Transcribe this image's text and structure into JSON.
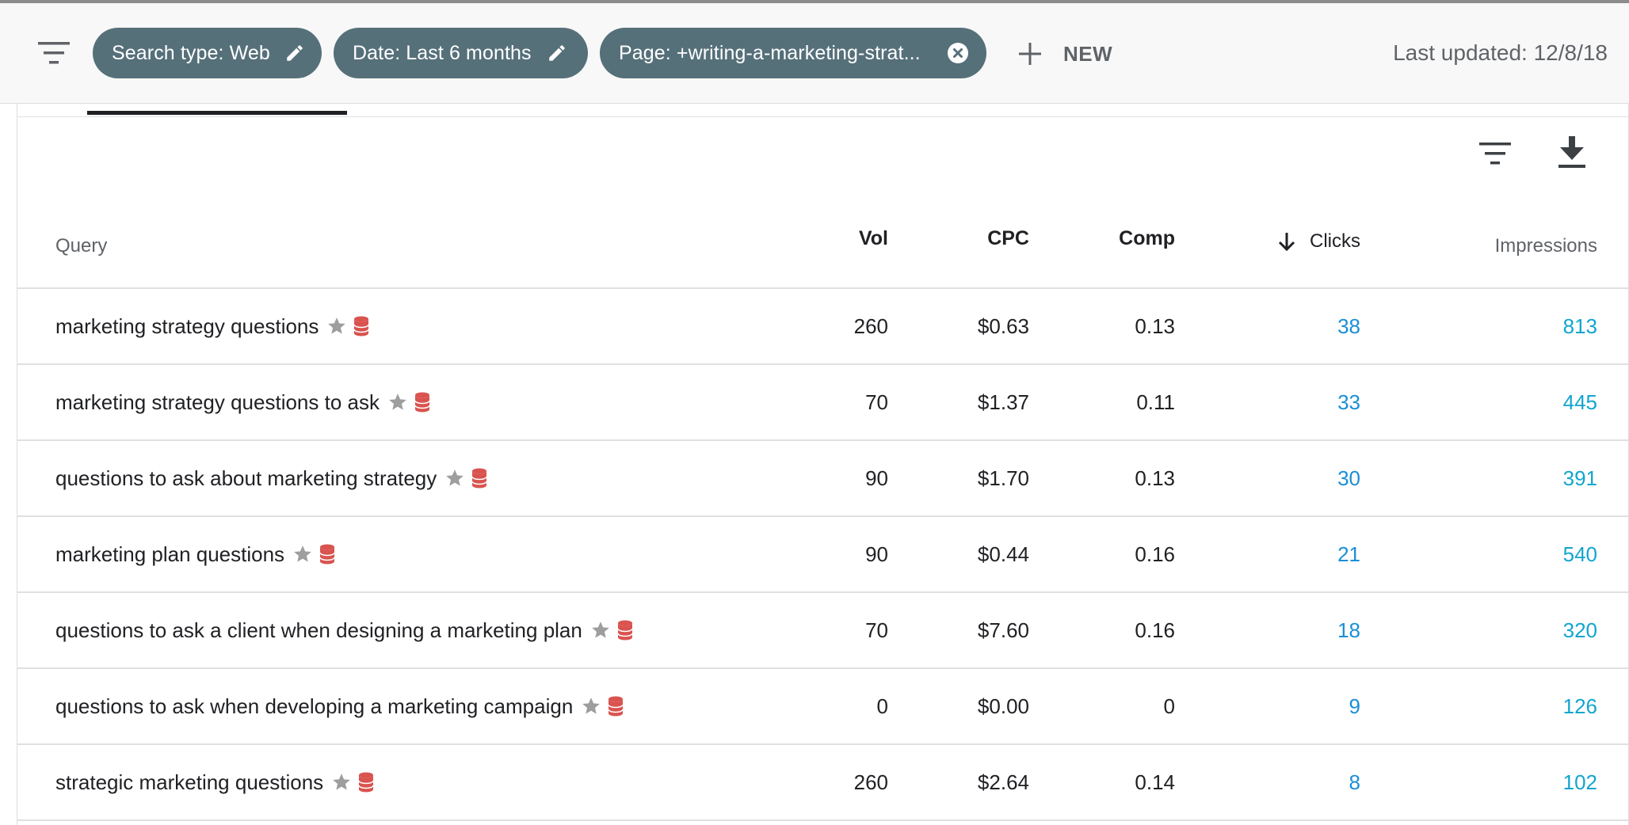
{
  "filters": {
    "chips": [
      {
        "label": "Search type: Web",
        "icon": "pencil-icon"
      },
      {
        "label": "Date: Last 6 months",
        "icon": "pencil-icon"
      },
      {
        "label": "Page: +writing-a-marketing-strat...",
        "icon": "close-circle-icon"
      }
    ],
    "new_label": "NEW",
    "last_updated": "Last updated: 12/8/18"
  },
  "table": {
    "columns": {
      "query": "Query",
      "vol": "Vol",
      "cpc": "CPC",
      "comp": "Comp",
      "clicks": "Clicks",
      "impressions": "Impressions"
    },
    "sort": {
      "column": "Clicks",
      "direction": "descending"
    },
    "rows": [
      {
        "query": "marketing strategy questions",
        "vol": "260",
        "cpc": "$0.63",
        "comp": "0.13",
        "clicks": "38",
        "impressions": "813"
      },
      {
        "query": "marketing strategy questions to ask",
        "vol": "70",
        "cpc": "$1.37",
        "comp": "0.11",
        "clicks": "33",
        "impressions": "445"
      },
      {
        "query": "questions to ask about marketing strategy",
        "vol": "90",
        "cpc": "$1.70",
        "comp": "0.13",
        "clicks": "30",
        "impressions": "391"
      },
      {
        "query": "marketing plan questions",
        "vol": "90",
        "cpc": "$0.44",
        "comp": "0.16",
        "clicks": "21",
        "impressions": "540"
      },
      {
        "query": "questions to ask a client when designing a marketing plan",
        "vol": "70",
        "cpc": "$7.60",
        "comp": "0.16",
        "clicks": "18",
        "impressions": "320"
      },
      {
        "query": "questions to ask when developing a marketing campaign",
        "vol": "0",
        "cpc": "$0.00",
        "comp": "0",
        "clicks": "9",
        "impressions": "126"
      },
      {
        "query": "strategic marketing questions",
        "vol": "260",
        "cpc": "$2.64",
        "comp": "0.14",
        "clicks": "8",
        "impressions": "102"
      }
    ]
  },
  "colors": {
    "chip_bg": "#56707a",
    "clicks": "#1a8fd6",
    "impressions": "#12a5cf",
    "star": "#9e9e9e",
    "database": "#d9534f"
  }
}
